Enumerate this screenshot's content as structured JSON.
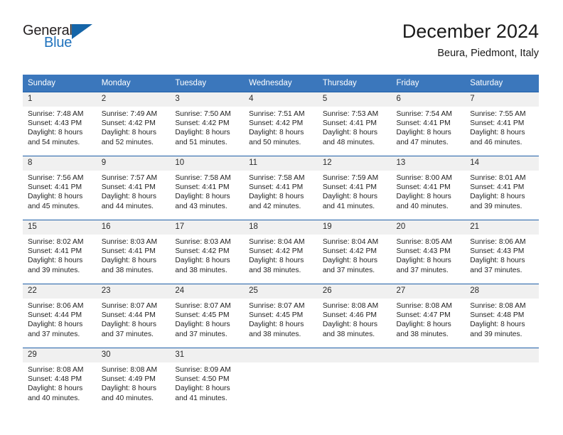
{
  "brand": {
    "name_part1": "General",
    "name_part2": "Blue",
    "triangle_color": "#1565a8",
    "blue_color": "#1f72bd"
  },
  "header": {
    "month_title": "December 2024",
    "location": "Beura, Piedmont, Italy"
  },
  "theme": {
    "header_bg": "#3b77bc",
    "row_border": "#1f5fa8",
    "daynum_bg": "#f0f0f0"
  },
  "weekday_headers": [
    "Sunday",
    "Monday",
    "Tuesday",
    "Wednesday",
    "Thursday",
    "Friday",
    "Saturday"
  ],
  "weeks": [
    [
      {
        "day": "1",
        "sunrise": "Sunrise: 7:48 AM",
        "sunset": "Sunset: 4:43 PM",
        "daylight_line1": "Daylight: 8 hours",
        "daylight_line2": "and 54 minutes."
      },
      {
        "day": "2",
        "sunrise": "Sunrise: 7:49 AM",
        "sunset": "Sunset: 4:42 PM",
        "daylight_line1": "Daylight: 8 hours",
        "daylight_line2": "and 52 minutes."
      },
      {
        "day": "3",
        "sunrise": "Sunrise: 7:50 AM",
        "sunset": "Sunset: 4:42 PM",
        "daylight_line1": "Daylight: 8 hours",
        "daylight_line2": "and 51 minutes."
      },
      {
        "day": "4",
        "sunrise": "Sunrise: 7:51 AM",
        "sunset": "Sunset: 4:42 PM",
        "daylight_line1": "Daylight: 8 hours",
        "daylight_line2": "and 50 minutes."
      },
      {
        "day": "5",
        "sunrise": "Sunrise: 7:53 AM",
        "sunset": "Sunset: 4:41 PM",
        "daylight_line1": "Daylight: 8 hours",
        "daylight_line2": "and 48 minutes."
      },
      {
        "day": "6",
        "sunrise": "Sunrise: 7:54 AM",
        "sunset": "Sunset: 4:41 PM",
        "daylight_line1": "Daylight: 8 hours",
        "daylight_line2": "and 47 minutes."
      },
      {
        "day": "7",
        "sunrise": "Sunrise: 7:55 AM",
        "sunset": "Sunset: 4:41 PM",
        "daylight_line1": "Daylight: 8 hours",
        "daylight_line2": "and 46 minutes."
      }
    ],
    [
      {
        "day": "8",
        "sunrise": "Sunrise: 7:56 AM",
        "sunset": "Sunset: 4:41 PM",
        "daylight_line1": "Daylight: 8 hours",
        "daylight_line2": "and 45 minutes."
      },
      {
        "day": "9",
        "sunrise": "Sunrise: 7:57 AM",
        "sunset": "Sunset: 4:41 PM",
        "daylight_line1": "Daylight: 8 hours",
        "daylight_line2": "and 44 minutes."
      },
      {
        "day": "10",
        "sunrise": "Sunrise: 7:58 AM",
        "sunset": "Sunset: 4:41 PM",
        "daylight_line1": "Daylight: 8 hours",
        "daylight_line2": "and 43 minutes."
      },
      {
        "day": "11",
        "sunrise": "Sunrise: 7:58 AM",
        "sunset": "Sunset: 4:41 PM",
        "daylight_line1": "Daylight: 8 hours",
        "daylight_line2": "and 42 minutes."
      },
      {
        "day": "12",
        "sunrise": "Sunrise: 7:59 AM",
        "sunset": "Sunset: 4:41 PM",
        "daylight_line1": "Daylight: 8 hours",
        "daylight_line2": "and 41 minutes."
      },
      {
        "day": "13",
        "sunrise": "Sunrise: 8:00 AM",
        "sunset": "Sunset: 4:41 PM",
        "daylight_line1": "Daylight: 8 hours",
        "daylight_line2": "and 40 minutes."
      },
      {
        "day": "14",
        "sunrise": "Sunrise: 8:01 AM",
        "sunset": "Sunset: 4:41 PM",
        "daylight_line1": "Daylight: 8 hours",
        "daylight_line2": "and 39 minutes."
      }
    ],
    [
      {
        "day": "15",
        "sunrise": "Sunrise: 8:02 AM",
        "sunset": "Sunset: 4:41 PM",
        "daylight_line1": "Daylight: 8 hours",
        "daylight_line2": "and 39 minutes."
      },
      {
        "day": "16",
        "sunrise": "Sunrise: 8:03 AM",
        "sunset": "Sunset: 4:41 PM",
        "daylight_line1": "Daylight: 8 hours",
        "daylight_line2": "and 38 minutes."
      },
      {
        "day": "17",
        "sunrise": "Sunrise: 8:03 AM",
        "sunset": "Sunset: 4:42 PM",
        "daylight_line1": "Daylight: 8 hours",
        "daylight_line2": "and 38 minutes."
      },
      {
        "day": "18",
        "sunrise": "Sunrise: 8:04 AM",
        "sunset": "Sunset: 4:42 PM",
        "daylight_line1": "Daylight: 8 hours",
        "daylight_line2": "and 38 minutes."
      },
      {
        "day": "19",
        "sunrise": "Sunrise: 8:04 AM",
        "sunset": "Sunset: 4:42 PM",
        "daylight_line1": "Daylight: 8 hours",
        "daylight_line2": "and 37 minutes."
      },
      {
        "day": "20",
        "sunrise": "Sunrise: 8:05 AM",
        "sunset": "Sunset: 4:43 PM",
        "daylight_line1": "Daylight: 8 hours",
        "daylight_line2": "and 37 minutes."
      },
      {
        "day": "21",
        "sunrise": "Sunrise: 8:06 AM",
        "sunset": "Sunset: 4:43 PM",
        "daylight_line1": "Daylight: 8 hours",
        "daylight_line2": "and 37 minutes."
      }
    ],
    [
      {
        "day": "22",
        "sunrise": "Sunrise: 8:06 AM",
        "sunset": "Sunset: 4:44 PM",
        "daylight_line1": "Daylight: 8 hours",
        "daylight_line2": "and 37 minutes."
      },
      {
        "day": "23",
        "sunrise": "Sunrise: 8:07 AM",
        "sunset": "Sunset: 4:44 PM",
        "daylight_line1": "Daylight: 8 hours",
        "daylight_line2": "and 37 minutes."
      },
      {
        "day": "24",
        "sunrise": "Sunrise: 8:07 AM",
        "sunset": "Sunset: 4:45 PM",
        "daylight_line1": "Daylight: 8 hours",
        "daylight_line2": "and 37 minutes."
      },
      {
        "day": "25",
        "sunrise": "Sunrise: 8:07 AM",
        "sunset": "Sunset: 4:45 PM",
        "daylight_line1": "Daylight: 8 hours",
        "daylight_line2": "and 38 minutes."
      },
      {
        "day": "26",
        "sunrise": "Sunrise: 8:08 AM",
        "sunset": "Sunset: 4:46 PM",
        "daylight_line1": "Daylight: 8 hours",
        "daylight_line2": "and 38 minutes."
      },
      {
        "day": "27",
        "sunrise": "Sunrise: 8:08 AM",
        "sunset": "Sunset: 4:47 PM",
        "daylight_line1": "Daylight: 8 hours",
        "daylight_line2": "and 38 minutes."
      },
      {
        "day": "28",
        "sunrise": "Sunrise: 8:08 AM",
        "sunset": "Sunset: 4:48 PM",
        "daylight_line1": "Daylight: 8 hours",
        "daylight_line2": "and 39 minutes."
      }
    ],
    [
      {
        "day": "29",
        "sunrise": "Sunrise: 8:08 AM",
        "sunset": "Sunset: 4:48 PM",
        "daylight_line1": "Daylight: 8 hours",
        "daylight_line2": "and 40 minutes."
      },
      {
        "day": "30",
        "sunrise": "Sunrise: 8:08 AM",
        "sunset": "Sunset: 4:49 PM",
        "daylight_line1": "Daylight: 8 hours",
        "daylight_line2": "and 40 minutes."
      },
      {
        "day": "31",
        "sunrise": "Sunrise: 8:09 AM",
        "sunset": "Sunset: 4:50 PM",
        "daylight_line1": "Daylight: 8 hours",
        "daylight_line2": "and 41 minutes."
      },
      {
        "day": "",
        "sunrise": "",
        "sunset": "",
        "daylight_line1": "",
        "daylight_line2": ""
      },
      {
        "day": "",
        "sunrise": "",
        "sunset": "",
        "daylight_line1": "",
        "daylight_line2": ""
      },
      {
        "day": "",
        "sunrise": "",
        "sunset": "",
        "daylight_line1": "",
        "daylight_line2": ""
      },
      {
        "day": "",
        "sunrise": "",
        "sunset": "",
        "daylight_line1": "",
        "daylight_line2": ""
      }
    ]
  ]
}
